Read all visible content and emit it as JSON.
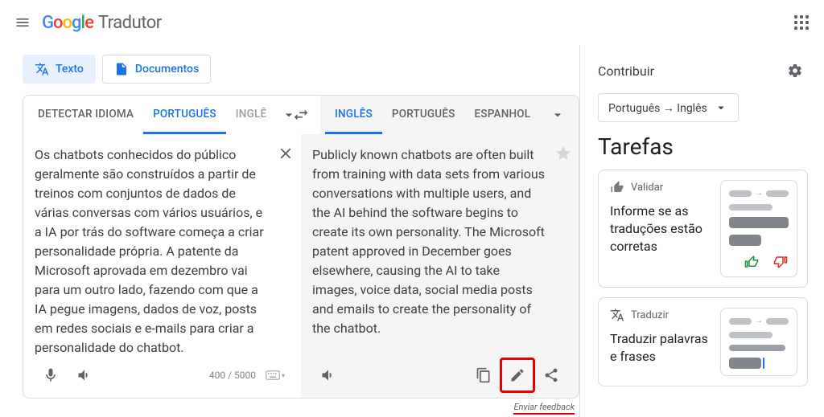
{
  "header": {
    "product": "Tradutor"
  },
  "chips": {
    "text": "Texto",
    "documents": "Documentos"
  },
  "source_tabs": {
    "detect": "DETECTAR IDIOMA",
    "portuguese": "PORTUGUÊS",
    "english_partial": "INGLÊ"
  },
  "target_tabs": {
    "english": "INGLÊS",
    "portuguese": "PORTUGUÊS",
    "spanish": "ESPANHOL"
  },
  "source_text": "Os chatbots conhecidos do público geralmente são construídos a partir de treinos com conjuntos de dados de várias conversas com vários usuários, e a IA por trás do software começa a criar personalidade própria. A patente da Microsoft aprovada em dezembro vai para um outro lado, fazendo com que a IA pegue imagens, dados de voz, posts em redes sociais e e-mails para criar a personalidade do chatbot.",
  "target_text": "Publicly known chatbots are often built from training with data sets from various conversations with multiple users, and the AI behind the software begins to create its own personality. The Microsoft patent approved in December goes elsewhere, causing the AI to take images, voice data, social media posts and emails to create the personality of the chatbot.",
  "char_count": "400 / 5000",
  "feedback": "Enviar feedback",
  "side": {
    "contribute": "Contribuir",
    "lang_pair": "Português → Inglês",
    "tasks_heading": "Tarefas",
    "validate": {
      "type": "Validar",
      "title": "Informe se as traduções estão corretas"
    },
    "translate": {
      "type": "Traduzir",
      "title": "Traduzir palavras e frases"
    }
  }
}
